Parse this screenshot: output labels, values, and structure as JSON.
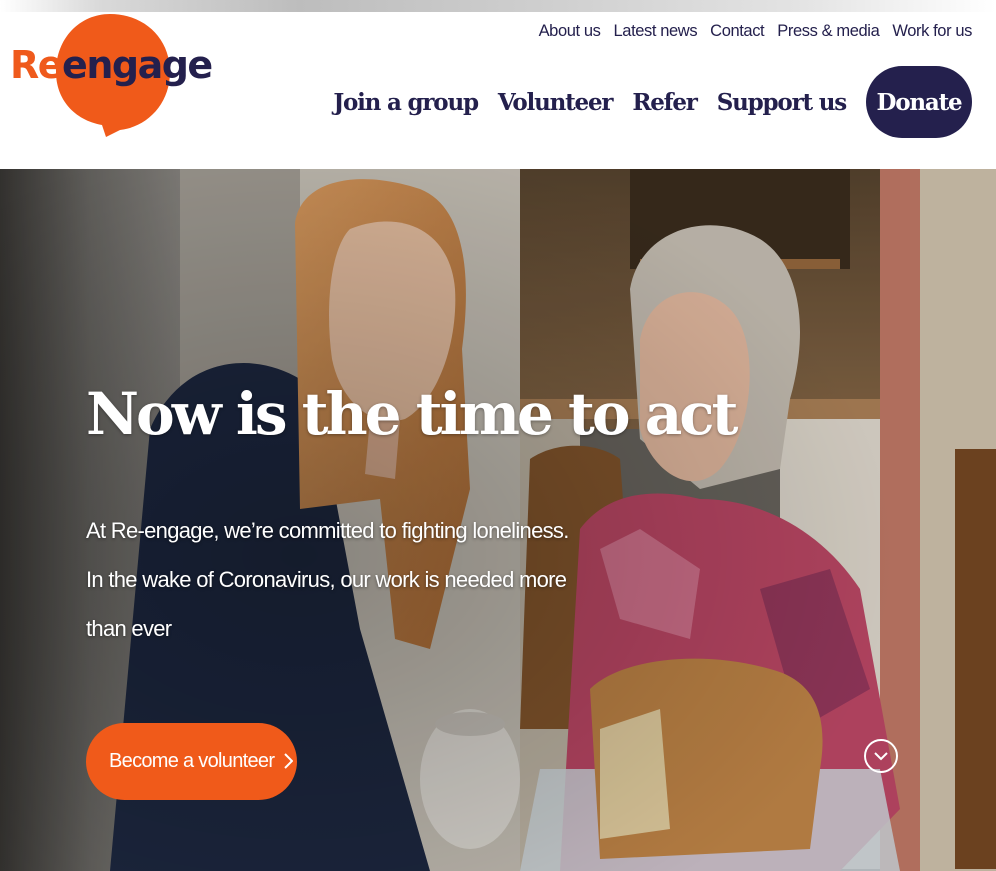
{
  "brand": {
    "logo_text_a": "Re",
    "logo_text_b": "engage",
    "colors": {
      "orange": "#f05a1a",
      "navy": "#24204d"
    }
  },
  "utility_nav": [
    "About us",
    "Latest news",
    "Contact",
    "Press & media",
    "Work for us"
  ],
  "main_nav": [
    "Join a group",
    "Volunteer",
    "Refer",
    "Support us"
  ],
  "donate_label": "Donate",
  "hero": {
    "title": "Now is the time to act",
    "text": "At Re-engage, we’re committed to fighting loneliness. In the wake of Coronavirus, our work is needed more than ever",
    "cta_label": "Become a volunteer",
    "cta_icon": "chevron-right-icon",
    "scroll_icon": "chevron-down-circle-icon"
  }
}
